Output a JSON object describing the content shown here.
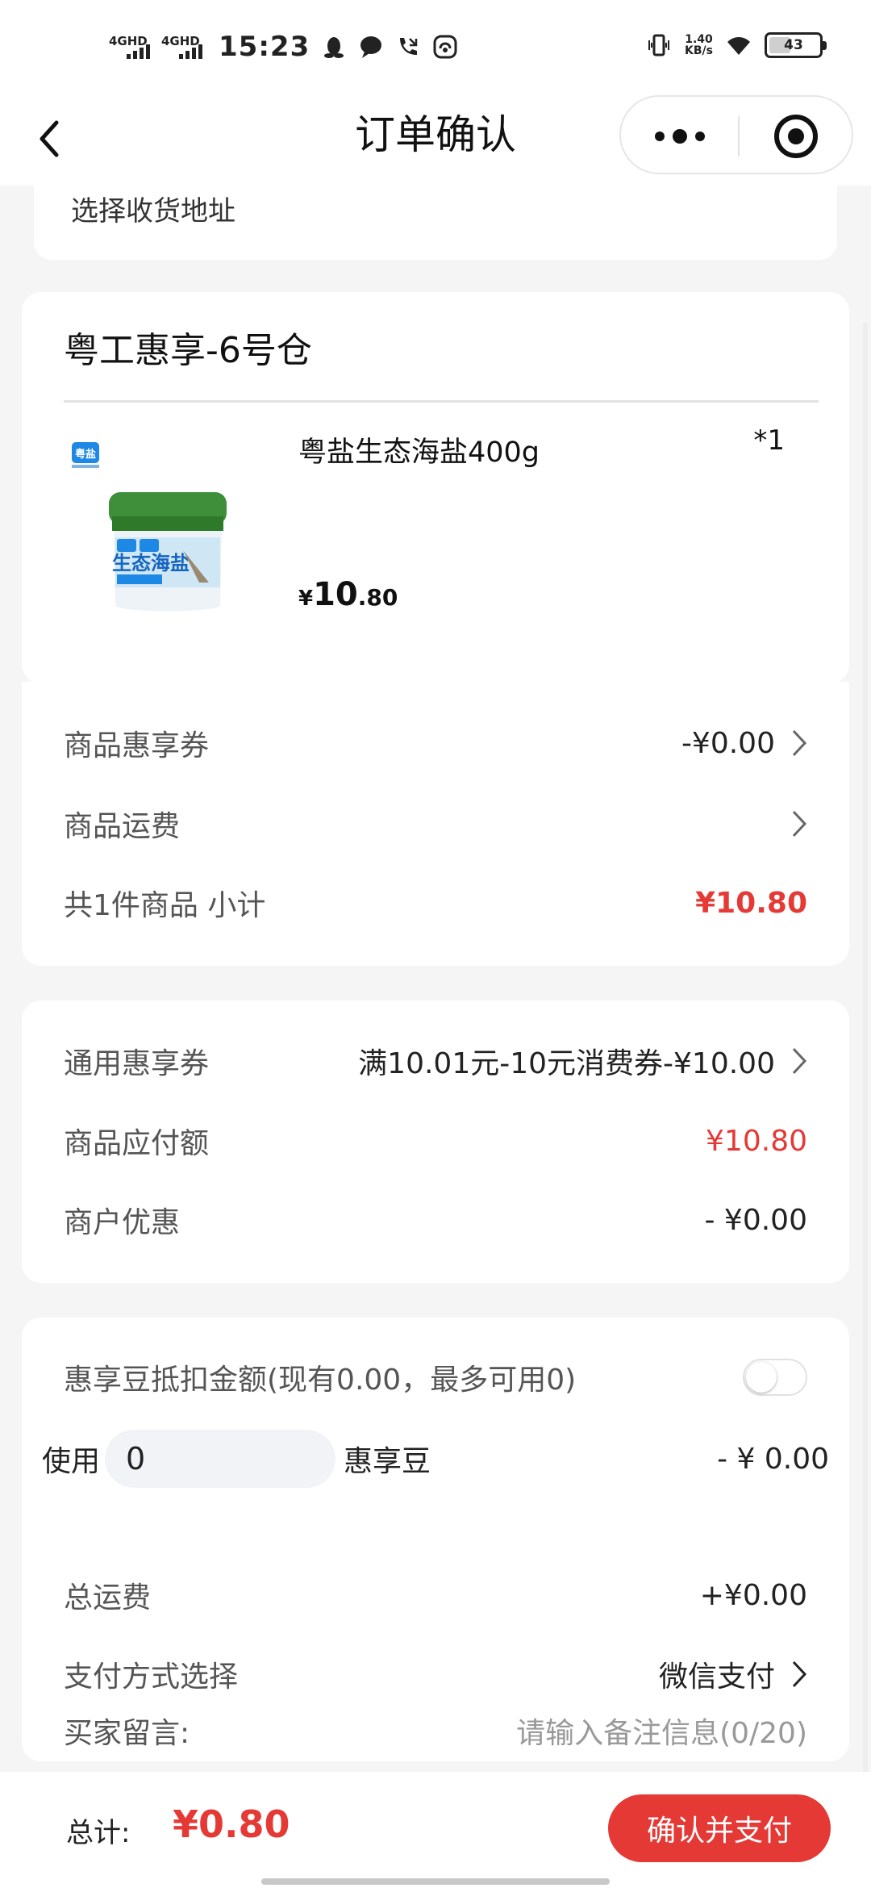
{
  "status_bar": {
    "net1": "4GHD",
    "net2": "4GHD",
    "time": "15:23",
    "speed_value": "1.40",
    "speed_unit": "KB/s",
    "battery": "43"
  },
  "nav": {
    "title": "订单确认"
  },
  "address": {
    "placeholder": "选择收货地址"
  },
  "shop": {
    "name": "粤工惠享-6号仓",
    "product": {
      "name": "粤盐生态海盐400g",
      "quantity": "*1",
      "price_currency": "¥",
      "price_int": "10",
      "price_dec": ".80",
      "image_brand": "粤盐",
      "image_title": "生态海盐"
    }
  },
  "goods_summary": {
    "coupon_label": "商品惠享券",
    "coupon_value": "-¥0.00",
    "shipping_label": "商品运费",
    "subtotal_label": "共1件商品 小计",
    "subtotal_value": "¥10.80"
  },
  "discounts": {
    "general_coupon_label": "通用惠享券",
    "general_coupon_value": "满10.01元-10元消费券-¥10.00",
    "payable_label": "商品应付额",
    "payable_value": "¥10.80",
    "merchant_label": "商户优惠",
    "merchant_value": "- ¥0.00"
  },
  "payment": {
    "beans_label": "惠享豆抵扣金额(现有0.00，最多可用0)",
    "beans_toggle_on": false,
    "use_label": "使用",
    "use_value": "0",
    "use_unit": "惠享豆",
    "use_deduction": "- ¥ 0.00",
    "total_shipping_label": "总运费",
    "total_shipping_value": "+¥0.00",
    "method_label": "支付方式选择",
    "method_value": "微信支付",
    "message_label": "买家留言:",
    "message_placeholder": "请输入备注信息(0/20)"
  },
  "footer": {
    "total_label": "总计:",
    "total_value": "¥0.80",
    "pay_button": "确认并支付"
  },
  "colors": {
    "accent_red": "#e53935",
    "background": "#f5f5f5"
  }
}
